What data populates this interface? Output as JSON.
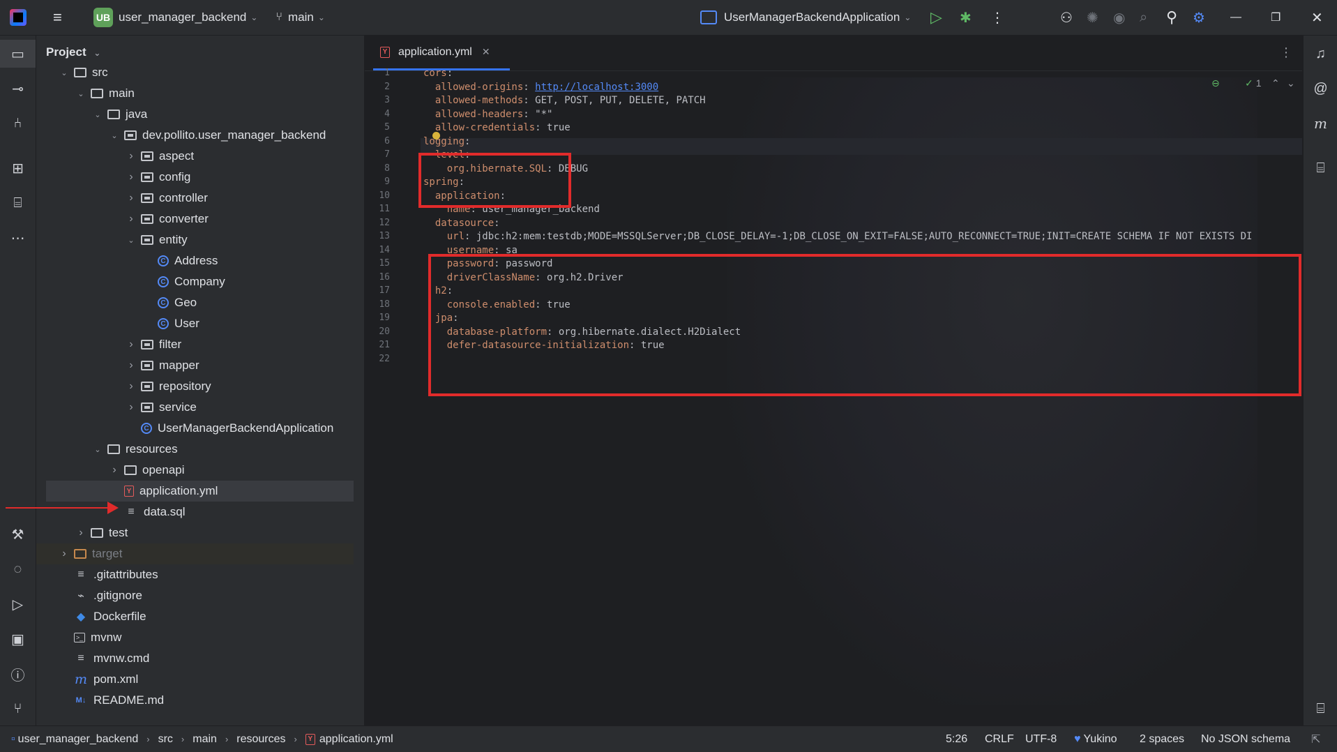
{
  "titlebar": {
    "project_badge": "UB",
    "project_name": "user_manager_backend",
    "branch": "main",
    "run_config": "UserManagerBackendApplication"
  },
  "project_panel": {
    "title": "Project",
    "tree": [
      {
        "label": "src",
        "icon": "folder-icon",
        "depth": 1,
        "expanded": true
      },
      {
        "label": "main",
        "icon": "folder-icon",
        "depth": 2,
        "expanded": true
      },
      {
        "label": "java",
        "icon": "source-folder-icon",
        "depth": 3,
        "expanded": true
      },
      {
        "label": "dev.pollito.user_manager_backend",
        "icon": "package-icon",
        "depth": 4,
        "expanded": true
      },
      {
        "label": "aspect",
        "icon": "package-icon",
        "depth": 5,
        "expanded": false
      },
      {
        "label": "config",
        "icon": "package-icon",
        "depth": 5,
        "expanded": false
      },
      {
        "label": "controller",
        "icon": "package-icon",
        "depth": 5,
        "expanded": false
      },
      {
        "label": "converter",
        "icon": "package-icon",
        "depth": 5,
        "expanded": false
      },
      {
        "label": "entity",
        "icon": "package-icon",
        "depth": 5,
        "expanded": true
      },
      {
        "label": "Address",
        "icon": "class-icon",
        "depth": 6
      },
      {
        "label": "Company",
        "icon": "class-icon",
        "depth": 6
      },
      {
        "label": "Geo",
        "icon": "class-icon",
        "depth": 6
      },
      {
        "label": "User",
        "icon": "class-icon",
        "depth": 6
      },
      {
        "label": "filter",
        "icon": "package-icon",
        "depth": 5,
        "expanded": false
      },
      {
        "label": "mapper",
        "icon": "package-icon",
        "depth": 5,
        "expanded": false
      },
      {
        "label": "repository",
        "icon": "package-icon",
        "depth": 5,
        "expanded": false
      },
      {
        "label": "service",
        "icon": "package-icon",
        "depth": 5,
        "expanded": false
      },
      {
        "label": "UserManagerBackendApplication",
        "icon": "class-icon",
        "depth": 5
      },
      {
        "label": "resources",
        "icon": "resources-folder-icon",
        "depth": 3,
        "expanded": true
      },
      {
        "label": "openapi",
        "icon": "folder-icon",
        "depth": 4,
        "expanded": false
      },
      {
        "label": "application.yml",
        "icon": "yaml-file-icon",
        "depth": 4,
        "selected": true
      },
      {
        "label": "data.sql",
        "icon": "text-file-icon",
        "depth": 4
      },
      {
        "label": "test",
        "icon": "folder-icon",
        "depth": 2,
        "expanded": false
      },
      {
        "label": "target",
        "icon": "excluded-folder-icon",
        "depth": 1,
        "expanded": false,
        "dim": true
      },
      {
        "label": ".gitattributes",
        "icon": "text-file-icon",
        "depth": 1
      },
      {
        "label": ".gitignore",
        "icon": "gitignore-icon",
        "depth": 1
      },
      {
        "label": "Dockerfile",
        "icon": "docker-icon",
        "depth": 1
      },
      {
        "label": "mvnw",
        "icon": "terminal-file-icon",
        "depth": 1
      },
      {
        "label": "mvnw.cmd",
        "icon": "text-file-icon",
        "depth": 1
      },
      {
        "label": "pom.xml",
        "icon": "maven-icon",
        "depth": 1
      },
      {
        "label": "README.md",
        "icon": "markdown-icon",
        "depth": 1
      }
    ]
  },
  "editor": {
    "tab_label": "application.yml",
    "inspection_count": "1",
    "lines": [
      [
        {
          "t": "cors",
          "c": "k"
        },
        {
          "t": ":",
          "c": "v"
        }
      ],
      [
        {
          "t": "  allowed-origins",
          "c": "k"
        },
        {
          "t": ": ",
          "c": "v"
        },
        {
          "t": "http://localhost:3000",
          "c": "url"
        }
      ],
      [
        {
          "t": "  allowed-methods",
          "c": "k"
        },
        {
          "t": ": GET, POST, PUT, DELETE, PATCH",
          "c": "v"
        }
      ],
      [
        {
          "t": "  allowed-headers",
          "c": "k"
        },
        {
          "t": ": \"*\"",
          "c": "v"
        }
      ],
      [
        {
          "t": "  allow-credentials",
          "c": "k"
        },
        {
          "t": ": true",
          "c": "v"
        }
      ],
      [
        {
          "t": "logging",
          "c": "k"
        },
        {
          "t": ":",
          "c": "v"
        }
      ],
      [
        {
          "t": "  level",
          "c": "k"
        },
        {
          "t": ":",
          "c": "v"
        }
      ],
      [
        {
          "t": "    org.hibernate.SQL",
          "c": "k"
        },
        {
          "t": ": DEBUG",
          "c": "v"
        }
      ],
      [
        {
          "t": "spring",
          "c": "k"
        },
        {
          "t": ":",
          "c": "v"
        }
      ],
      [
        {
          "t": "  application",
          "c": "k"
        },
        {
          "t": ":",
          "c": "v"
        }
      ],
      [
        {
          "t": "    name",
          "c": "k"
        },
        {
          "t": ": user_manager_backend",
          "c": "v"
        }
      ],
      [
        {
          "t": "  datasource",
          "c": "k"
        },
        {
          "t": ":",
          "c": "v"
        }
      ],
      [
        {
          "t": "    url",
          "c": "k"
        },
        {
          "t": ": jdbc:h2:mem:testdb;MODE=MSSQLServer;DB_CLOSE_DELAY=-1;DB_CLOSE_ON_EXIT=FALSE;AUTO_RECONNECT=TRUE;INIT=CREATE SCHEMA IF NOT EXISTS DI",
          "c": "v"
        }
      ],
      [
        {
          "t": "    username",
          "c": "k"
        },
        {
          "t": ": sa",
          "c": "v"
        }
      ],
      [
        {
          "t": "    password",
          "c": "k"
        },
        {
          "t": ": password",
          "c": "v"
        }
      ],
      [
        {
          "t": "    driverClassName",
          "c": "k"
        },
        {
          "t": ": org.h2.Driver",
          "c": "v"
        }
      ],
      [
        {
          "t": "  h2",
          "c": "k"
        },
        {
          "t": ":",
          "c": "v"
        }
      ],
      [
        {
          "t": "    console.enabled",
          "c": "k"
        },
        {
          "t": ": true",
          "c": "v"
        }
      ],
      [
        {
          "t": "  jpa",
          "c": "k"
        },
        {
          "t": ":",
          "c": "v"
        }
      ],
      [
        {
          "t": "    database-platform",
          "c": "k"
        },
        {
          "t": ": org.hibernate.dialect.H2Dialect",
          "c": "v"
        }
      ],
      [
        {
          "t": "    defer-datasource-initialization",
          "c": "k"
        },
        {
          "t": ": true",
          "c": "v"
        }
      ],
      []
    ]
  },
  "statusbar": {
    "breadcrumbs": [
      "user_manager_backend",
      "src",
      "main",
      "resources",
      "application.yml"
    ],
    "position": "5:26",
    "line_separator": "CRLF",
    "encoding": "UTF-8",
    "theme": "Yukino",
    "indent": "2 spaces",
    "schema": "No JSON schema"
  },
  "colors": {
    "accent": "#3574f0",
    "highlight_box": "#e12b2b",
    "yaml_key": "#cf8e6d"
  }
}
